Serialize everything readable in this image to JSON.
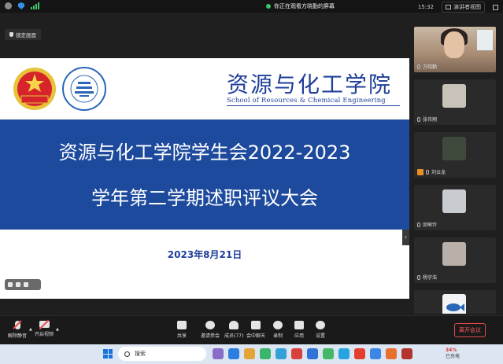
{
  "topbar": {
    "viewing_text": "你正在观看方晓勤的屏幕",
    "time": "15:32",
    "view_label": "演讲者视图"
  },
  "lock_screen_label": "锁定画面",
  "slide": {
    "school_cn": "资源与化工学院",
    "school_en": "School of Resources & Chemical Engineering",
    "title_line1": "资源与化工学院学生会2022-2023",
    "title_line2": "学年第二学期述职评议大会",
    "date": "2023年8月21日",
    "banner_color": "#1d4a9d",
    "emblem_text": "中国共青团"
  },
  "participants": [
    {
      "name": "方晓勤",
      "kind": "video"
    },
    {
      "name": "张伟翔",
      "kind": "avatar",
      "color": "#c9c2b8"
    },
    {
      "name": "刘云龙",
      "kind": "avatar",
      "color": "#3f4a3c",
      "sharing": true
    },
    {
      "name": "邱晰玲",
      "kind": "avatar",
      "color": "#c8cbd0"
    },
    {
      "name": "杨宇浩",
      "kind": "avatar",
      "color": "#b9b0aa"
    },
    {
      "name": "",
      "kind": "avatar",
      "color": "#f2f4f6"
    }
  ],
  "toolbar": {
    "mute": "解除静音",
    "video": "开启视频",
    "share": "共享",
    "invite": "邀请参会",
    "members": "成员(77)",
    "chat": "会中聊天",
    "record": "录制",
    "apps": "应用",
    "settings": "设置",
    "leave": "离开会议"
  },
  "taskbar": {
    "search": "搜索",
    "battery": "34%",
    "battery_label": "已充电"
  },
  "colors": {
    "accent_blue": "#1e3f9a",
    "leave_red": "#e24a4a"
  }
}
